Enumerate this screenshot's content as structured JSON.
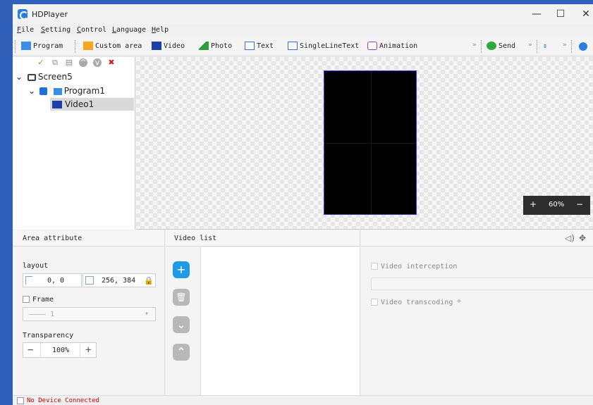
{
  "app": {
    "title": "HDPlayer"
  },
  "window_controls": {
    "minimize": "—",
    "maximize": "☐",
    "close": "✕"
  },
  "menu": [
    "File",
    "Setting",
    "Control",
    "Language",
    "Help"
  ],
  "toolbar": {
    "program": "Program",
    "custom_area": "Custom area",
    "video": "Video",
    "photo": "Photo",
    "text": "Text",
    "single_line_text": "SingleLineText",
    "animation": "Animation",
    "send": "Send",
    "overflow": "»"
  },
  "tree": {
    "screen": "Screen5",
    "program": "Program1",
    "video": "Video1"
  },
  "canvas": {
    "zoom_level": "60%",
    "zoom_in": "+",
    "zoom_out": "−"
  },
  "area_attribute": {
    "header": "Area attribute",
    "layout_label": "layout",
    "position": "0, 0",
    "size": "256, 384",
    "frame_label": "Frame",
    "frame_value": "———— 1",
    "transparency_label": "Transparency",
    "transparency_value": "100%",
    "minus": "−",
    "plus": "+"
  },
  "video_list": {
    "header": "Video list",
    "add": "+",
    "delete": "🗑",
    "down": "⌄",
    "up": "⌃"
  },
  "video_options": {
    "interception_label": "Video interception",
    "transcoding_label": "Video transcoding"
  },
  "status": {
    "text": "No Device Connected"
  }
}
